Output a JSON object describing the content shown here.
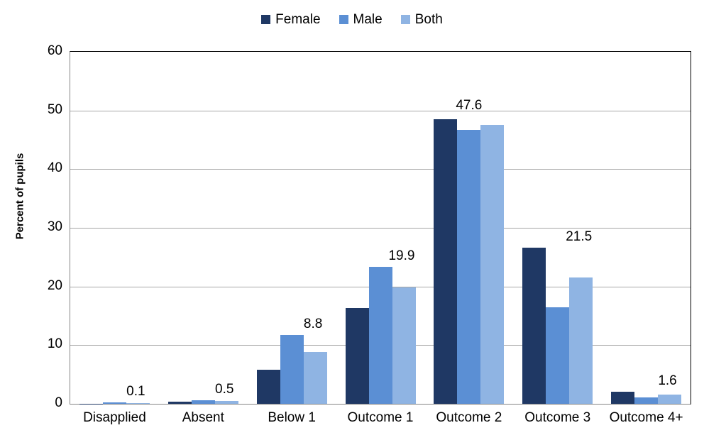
{
  "chart_data": {
    "type": "bar",
    "title": "",
    "subtitle": "",
    "xlabel": "",
    "ylabel": "Percent of pupils",
    "ylim": [
      0,
      60
    ],
    "ytick_step": 10,
    "yticks": [
      "60",
      "50",
      "40",
      "30",
      "20",
      "10",
      "0"
    ],
    "grid": true,
    "legend_position": "top-center",
    "categories": [
      "Disapplied",
      "Absent",
      "Below 1",
      "Outcome 1",
      "Outcome 2",
      "Outcome 3",
      "Outcome 4+"
    ],
    "series": [
      {
        "name": "Female",
        "color": "#1F3864",
        "values": [
          0.05,
          0.4,
          5.8,
          16.3,
          48.5,
          26.6,
          2.1
        ]
      },
      {
        "name": "Male",
        "color": "#5B8FD4",
        "values": [
          0.2,
          0.6,
          11.7,
          23.3,
          46.7,
          16.5,
          1.1
        ]
      },
      {
        "name": "Both",
        "color": "#8FB4E3",
        "values": [
          0.1,
          0.5,
          8.8,
          19.9,
          47.6,
          21.5,
          1.6
        ]
      }
    ],
    "data_labels": [
      "0.1",
      "0.5",
      "8.8",
      "19.9",
      "47.6",
      "21.5",
      "1.6"
    ],
    "data_label_series": "Both"
  },
  "colors": {
    "female": "#1F3864",
    "male": "#5B8FD4",
    "both": "#8FB4E3",
    "gridline": "#a6a6a6",
    "axis": "#858585",
    "text": "#000000",
    "background": "#ffffff"
  },
  "legend": {
    "items": [
      {
        "label": "Female",
        "color": "#1F3864"
      },
      {
        "label": "Male",
        "color": "#5B8FD4"
      },
      {
        "label": "Both",
        "color": "#8FB4E3"
      }
    ]
  }
}
